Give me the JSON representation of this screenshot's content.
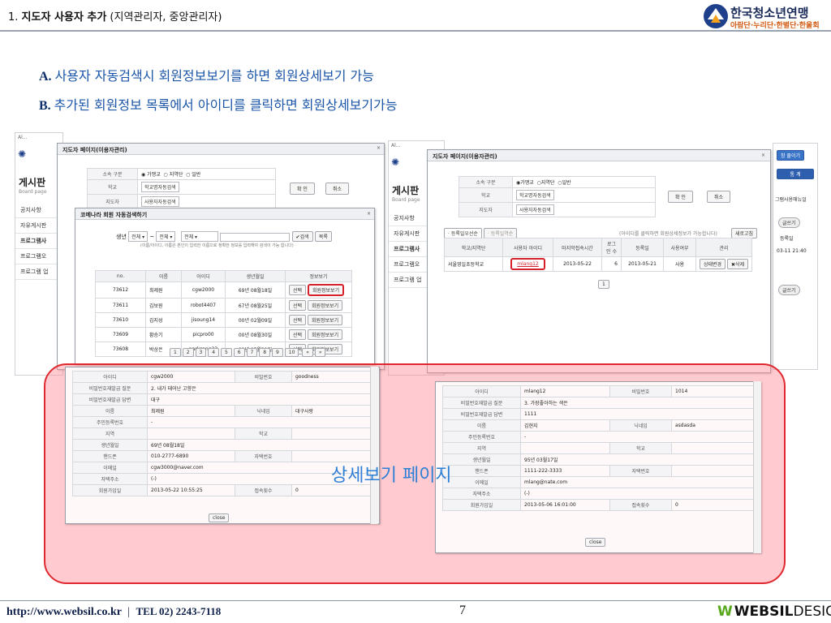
{
  "header": {
    "section_no": "1.",
    "title_bold": "지도자 사용자 추가",
    "title_paren": "(지역관리자, 중앙관리자)",
    "logo_name": "한국청소년연맹",
    "logo_sub": "아람단·누리단·한별단·한울회"
  },
  "notes": [
    {
      "tag": "A.",
      "text": "사용자 자동검색시 회원정보보기를 하면 회원상세보기 가능"
    },
    {
      "tag": "B.",
      "text": "추가된 회원정보 목록에서 아이디를 클릭하면 회원상세보기가능"
    }
  ],
  "left": {
    "top_label": "Al...",
    "board_title": "게시판",
    "board_sub": "Board page",
    "side_items": [
      "공지사항",
      "자유게시판",
      "프로그램사",
      "프로그램오",
      "프로그램 업"
    ],
    "page_window": {
      "title": "지도자 페이지(이용자관리)",
      "rows": [
        {
          "label": "소속 구분",
          "options": [
            "가맹교",
            "지역단",
            "일반"
          ]
        },
        {
          "label": "학교",
          "field": "학교명자동검색"
        },
        {
          "label": "지도자",
          "field": "사용자자동검색"
        }
      ],
      "btn_ok": "확 인",
      "btn_cancel": "취소"
    },
    "search_window": {
      "title": "코메나라 회원 자동검색하기",
      "birth_label": "생년",
      "sel1": "전체",
      "sel2": "전체",
      "sel3": "전체",
      "search_btn": "검색",
      "list_btn": "목록",
      "hint": "(이름/아이디, 이름은 본인이 입력한 이름으로 정확한 정보를 입력해야 검색이 가능 합니다)",
      "columns": [
        "no.",
        "이름",
        "아이디",
        "생년월일",
        "정보보기"
      ],
      "rows": [
        {
          "no": "73612",
          "name": "최제원",
          "id": "cgw2000",
          "birth": "69년 08월18일"
        },
        {
          "no": "73611",
          "name": "김보원",
          "id": "robot4407",
          "birth": "67년 08월25일"
        },
        {
          "no": "73610",
          "name": "김지성",
          "id": "jisoung14",
          "birth": "00년 02월09일"
        },
        {
          "no": "73609",
          "name": "황승기",
          "id": "picpro00",
          "birth": "00년 08월30일"
        },
        {
          "no": "73608",
          "name": "박상은",
          "id": "parksang23",
          "birth": "99년 05월21일"
        }
      ],
      "select_btn": "선택",
      "info_btn": "회원정보보기",
      "pages": [
        "1",
        "2",
        "3",
        "4",
        "5",
        "6",
        "7",
        "8",
        "9",
        "10"
      ],
      "next": "»",
      "prev": "«"
    },
    "detail": {
      "rows": [
        [
          "아이디",
          "cgw2000",
          "비밀번호",
          "goodness"
        ],
        [
          "비밀번호재발급 질문",
          "2. 내가 태어난 고향은",
          "",
          ""
        ],
        [
          "비밀번호재발급 답변",
          "대구",
          "",
          ""
        ],
        [
          "이름",
          "최제원",
          "닉네임",
          "대구사랑"
        ],
        [
          "주민등록번호",
          "-",
          "",
          ""
        ],
        [
          "지역",
          "",
          "학교",
          ""
        ],
        [
          "생년월일",
          "69년 08월18일",
          "",
          ""
        ],
        [
          "핸드폰",
          "010-2777-6890",
          "자택번호",
          ""
        ],
        [
          "이메일",
          "cgw3000@naver.com",
          "",
          ""
        ],
        [
          "자택주소",
          "(-)",
          "",
          ""
        ],
        [
          "회원가입일",
          "2013-05-22 10:55:25",
          "접속횟수",
          "0"
        ]
      ],
      "close": "close"
    }
  },
  "right": {
    "top_label": "Al...",
    "board_title": "게시판",
    "board_sub": "Board page",
    "side_items": [
      "공지사항",
      "자유게시판",
      "프로그램사",
      "프로그램오",
      "프로그램 업"
    ],
    "right_tabs": [
      "창 줄이기",
      "통 계"
    ],
    "right_menu": "그램사용매뉴얼",
    "right_col_head": "등록일",
    "right_col_val": "03-11 21:40",
    "right_badge": "글쓰기",
    "page_window": {
      "title": "지도자 페이지(이용자관리)",
      "rows": [
        {
          "label": "소속 구분",
          "options": [
            "가맹교",
            "지역단",
            "일반"
          ]
        },
        {
          "label": "학교",
          "field": "학교명자동검색"
        },
        {
          "label": "지도자",
          "field": "사용자자동검색"
        }
      ],
      "btn_ok": "확 인",
      "btn_cancel": "취소",
      "tabs": [
        "등록일우선순",
        "등록일역순"
      ],
      "hint": "(아이디를 클릭하면 회원상세정보가 가능합니다)",
      "refresh": "새로고침",
      "columns": [
        "학교/지역단",
        "사용자 아이디",
        "마지막접속시간",
        "로그인 수",
        "등록일",
        "사용여부",
        "관리"
      ],
      "row": {
        "school": "서울영일초등학교",
        "id": "mlang12",
        "last": "2013-05-22",
        "count": "6",
        "date": "2013-05-21",
        "use": "사용",
        "change": "상태변경",
        "del": "삭제"
      },
      "page": "1"
    },
    "detail": {
      "rows": [
        [
          "아이디",
          "mlang12",
          "비밀번호",
          "1014"
        ],
        [
          "비밀번호재발급 질문",
          "3. 가장좋아하는 색은",
          "",
          ""
        ],
        [
          "비밀번호재발급 답변",
          "1111",
          "",
          ""
        ],
        [
          "이름",
          "김현지",
          "닉네임",
          "asdasda"
        ],
        [
          "주민등록번호",
          "-",
          "",
          ""
        ],
        [
          "지역",
          "",
          "학교",
          ""
        ],
        [
          "생년월일",
          "95년 03월17일",
          "",
          ""
        ],
        [
          "핸드폰",
          "1111-222-3333",
          "자택번호",
          ""
        ],
        [
          "이메일",
          "mlang@nate.com",
          "",
          ""
        ],
        [
          "자택주소",
          "(-)",
          "",
          ""
        ],
        [
          "회원가입일",
          "2013-05-06 16:01:00",
          "접속횟수",
          "0"
        ]
      ],
      "close": "close"
    }
  },
  "overlay_label": "상세보기 페이지",
  "footer": {
    "url": "http://www.websil.co.kr",
    "sep": "|",
    "tel": "TEL 02) 2243-7118",
    "page": "7",
    "brand_bold": "WEBSIL",
    "brand_rest": "DESIGN"
  },
  "colors": {
    "accent": "#1a55a8",
    "overlay": "#ff8c96",
    "highlight": "#d6202a"
  }
}
